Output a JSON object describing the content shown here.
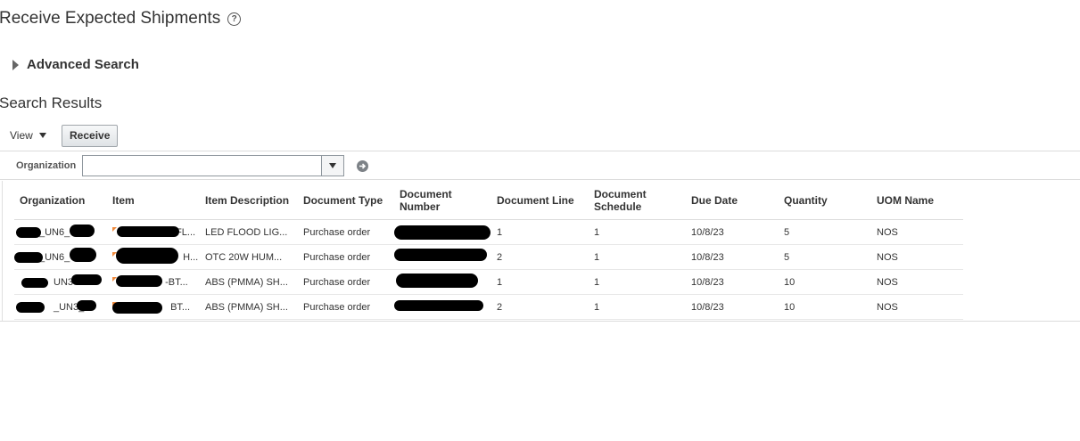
{
  "page": {
    "title": "Receive Expected Shipments"
  },
  "advanced_search": {
    "label": "Advanced Search"
  },
  "results": {
    "title": "Search Results",
    "view_label": "View",
    "receive_label": "Receive",
    "filter": {
      "label": "Organization",
      "value": ""
    },
    "columns": [
      "Organization",
      "Item",
      "Item Description",
      "Document Type",
      "Document Number",
      "Document Line",
      "Document Schedule",
      "Due Date",
      "Quantity",
      "UOM Name"
    ],
    "rows": [
      {
        "organization": "_UN6_",
        "item": "FL...",
        "item_description": "LED FLOOD LIG...",
        "document_type": "Purchase order",
        "document_number": "",
        "document_line": "1",
        "document_schedule": "1",
        "due_date": "10/8/23",
        "quantity": "5",
        "uom_name": "NOS"
      },
      {
        "organization": "_UN6_",
        "item": "H...",
        "item_description": "OTC 20W HUM...",
        "document_type": "Purchase order",
        "document_number": "",
        "document_line": "2",
        "document_schedule": "1",
        "due_date": "10/8/23",
        "quantity": "5",
        "uom_name": "NOS"
      },
      {
        "organization": "UN3",
        "item": "-BT...",
        "item_description": "ABS (PMMA) SH...",
        "document_type": "Purchase order",
        "document_number": "",
        "document_line": "1",
        "document_schedule": "1",
        "due_date": "10/8/23",
        "quantity": "10",
        "uom_name": "NOS"
      },
      {
        "organization": "_UN3_",
        "item": "BT...",
        "item_description": "ABS (PMMA) SH...",
        "document_type": "Purchase order",
        "document_number": "",
        "document_line": "2",
        "document_schedule": "1",
        "due_date": "10/8/23",
        "quantity": "10",
        "uom_name": "NOS"
      }
    ]
  },
  "colors": {
    "link": "#0572ce",
    "flag": "#f08a3c",
    "redaction": "#000000"
  }
}
